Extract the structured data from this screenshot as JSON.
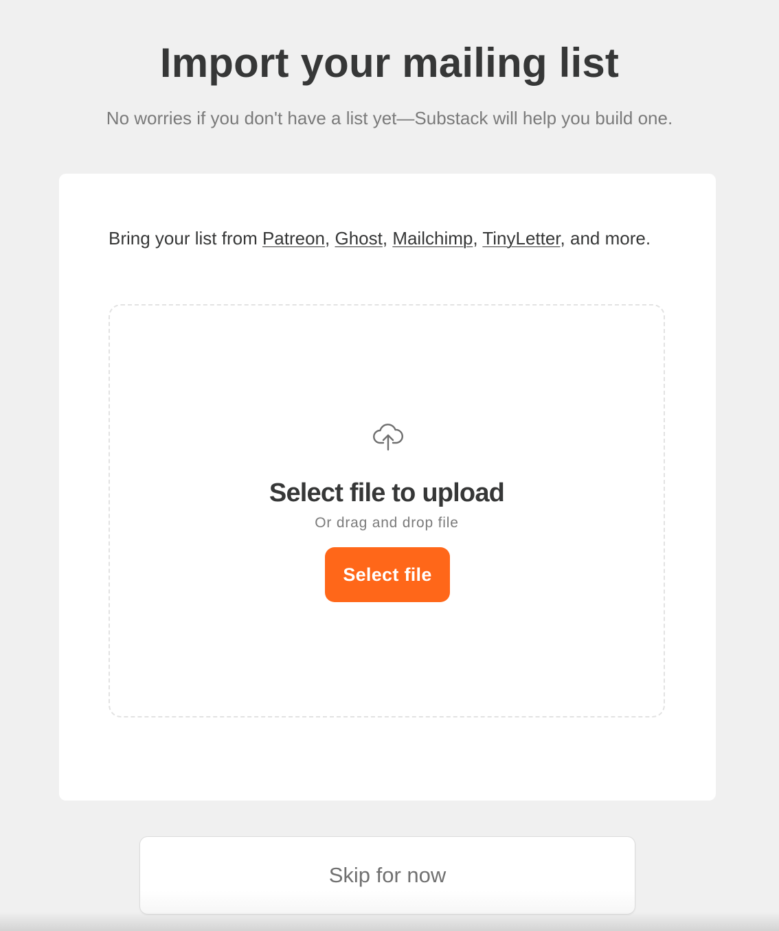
{
  "header": {
    "title": "Import your mailing list",
    "subtitle": "No worries if you don't have a list yet—Substack will help you build one."
  },
  "intro": {
    "prefix": "Bring your list from ",
    "links": [
      "Patreon",
      "Ghost",
      "Mailchimp",
      "TinyLetter"
    ],
    "separator": ", ",
    "suffix": ", and more."
  },
  "dropzone": {
    "icon": "cloud-upload-icon",
    "title": "Select file to upload",
    "subtitle": "Or drag and drop file",
    "button_label": "Select file"
  },
  "footer": {
    "skip_label": "Skip for now"
  },
  "colors": {
    "accent": "#ff6719",
    "background": "#f0f0f0",
    "card": "#ffffff",
    "text": "#363737",
    "muted": "#7a7a7a"
  }
}
